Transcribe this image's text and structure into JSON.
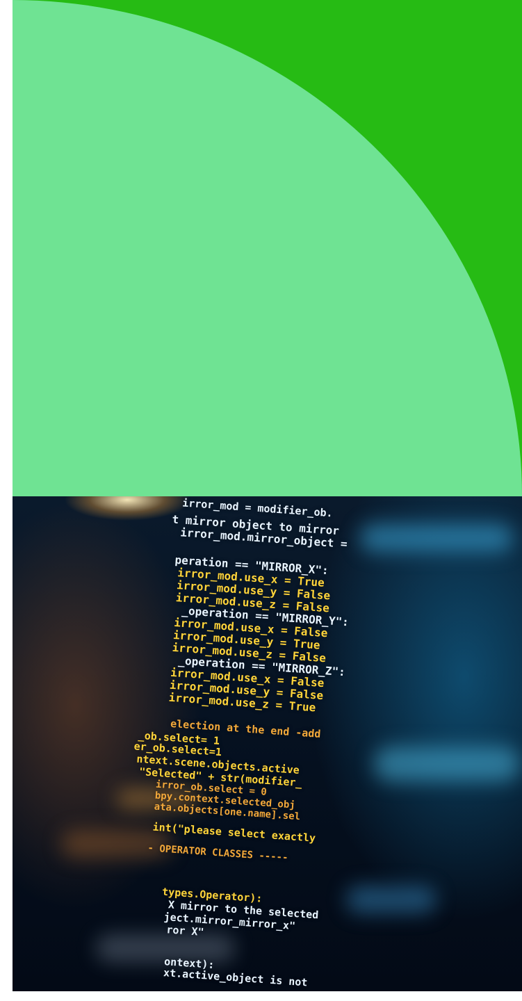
{
  "colors": {
    "panel_dark_green": "#26bb14",
    "panel_light_green": "#6fe393",
    "code_white": "#e8f4ff",
    "code_yellow": "#ffd43a",
    "code_orange": "#f2a83a"
  },
  "code_lines": [
    {
      "text": "irror_mod = modifier_ob.",
      "tone": "white"
    },
    {
      "text": "t mirror object to mirror",
      "tone": "white"
    },
    {
      "text": "irror_mod.mirror_object =",
      "tone": "white"
    },
    {
      "text": "peration == \"MIRROR_X\":",
      "tone": "white"
    },
    {
      "text": "irror_mod.use_x = True",
      "tone": "yellow"
    },
    {
      "text": "irror_mod.use_y = False",
      "tone": "yellow"
    },
    {
      "text": "irror_mod.use_z = False",
      "tone": "yellow"
    },
    {
      "text": "_operation == \"MIRROR_Y\":",
      "tone": "white"
    },
    {
      "text": "irror_mod.use_x = False",
      "tone": "yellow"
    },
    {
      "text": "irror_mod.use_y = True",
      "tone": "yellow"
    },
    {
      "text": "irror_mod.use_z = False",
      "tone": "yellow"
    },
    {
      "text": "_operation == \"MIRROR_Z\":",
      "tone": "white"
    },
    {
      "text": "irror_mod.use_x = False",
      "tone": "yellow"
    },
    {
      "text": "irror_mod.use_y = False",
      "tone": "yellow"
    },
    {
      "text": "irror_mod.use_z = True",
      "tone": "yellow"
    },
    {
      "text": "election at the end -add",
      "tone": "orange"
    },
    {
      "text": "_ob.select= 1",
      "tone": "yellow"
    },
    {
      "text": "er_ob.select=1",
      "tone": "yellow"
    },
    {
      "text": "ntext.scene.objects.active",
      "tone": "yellow"
    },
    {
      "text": "\"Selected\" + str(modifier_",
      "tone": "yellow"
    },
    {
      "text": "irror_ob.select = 0",
      "tone": "orange"
    },
    {
      "text": "bpy.context.selected_obj",
      "tone": "orange"
    },
    {
      "text": "ata.objects[one.name].sel",
      "tone": "orange"
    },
    {
      "text": "int(\"please select exactly",
      "tone": "yellow"
    },
    {
      "text": "- OPERATOR CLASSES -----",
      "tone": "orange"
    },
    {
      "text": "types.Operator):",
      "tone": "yellow"
    },
    {
      "text": "X mirror to the selected",
      "tone": "white"
    },
    {
      "text": "ject.mirror_mirror_x\"",
      "tone": "white"
    },
    {
      "text": "ror X\"",
      "tone": "white"
    },
    {
      "text": "ontext):",
      "tone": "white"
    },
    {
      "text": "xt.active_object is not",
      "tone": "white"
    }
  ]
}
